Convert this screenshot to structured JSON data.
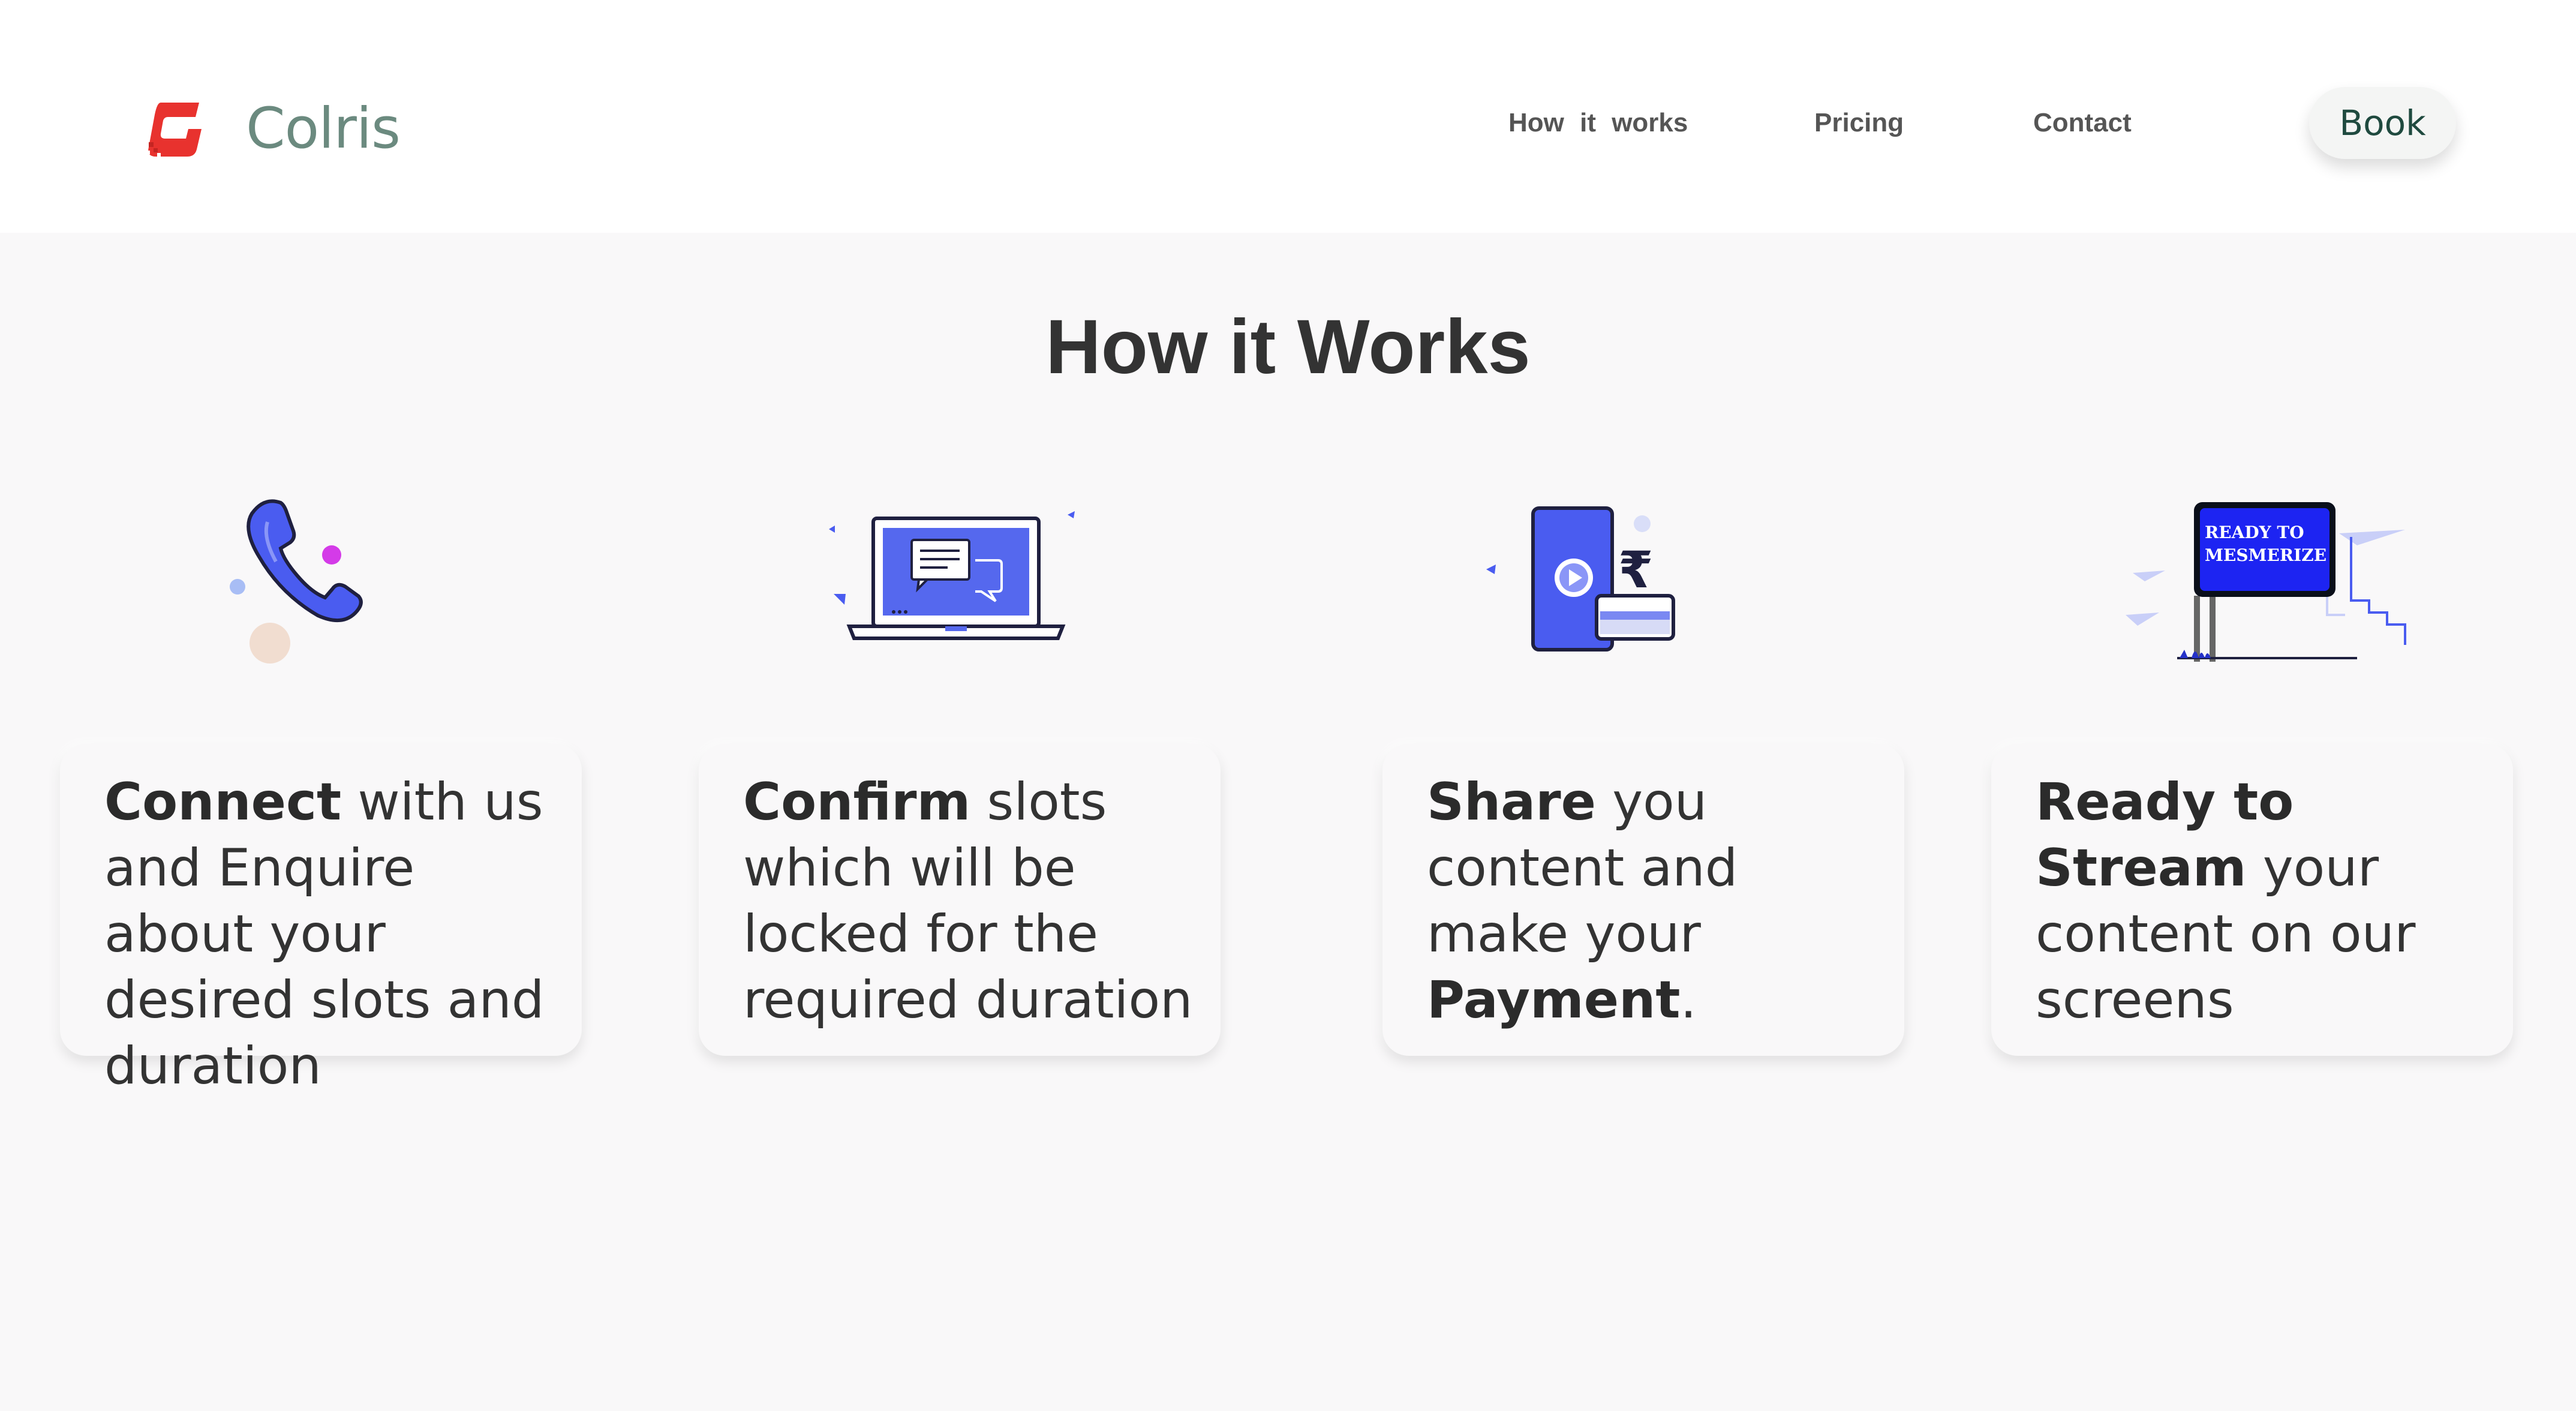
{
  "header": {
    "brand": "Colris",
    "nav": {
      "how_it_works": "How it works",
      "pricing": "Pricing",
      "contact": "Contact"
    },
    "book_label": "Book"
  },
  "section": {
    "title": "How it Works"
  },
  "steps": [
    {
      "bold": "Connect",
      "rest": " with us and Enquire about your desired slots and duration",
      "icon": "phone-icon"
    },
    {
      "bold": "Confirm",
      "rest": " slots which will be locked for the required duration",
      "icon": "laptop-chat-icon"
    },
    {
      "bold": "Share",
      "rest": " you content and make your ",
      "bold2": "Payment",
      "rest2": ".",
      "icon": "mobile-payment-icon"
    },
    {
      "bold": "Ready to Stream",
      "rest": " your content on our screens",
      "icon": "billboard-icon"
    }
  ],
  "billboard": {
    "line1": "READY TO",
    "line2": "MESMERIZE"
  },
  "payment": {
    "currency_symbol": "₹"
  },
  "colors": {
    "accent_blue": "#3b4ff0",
    "logo_red": "#e8322e",
    "brand_green": "#6b8a7f"
  }
}
